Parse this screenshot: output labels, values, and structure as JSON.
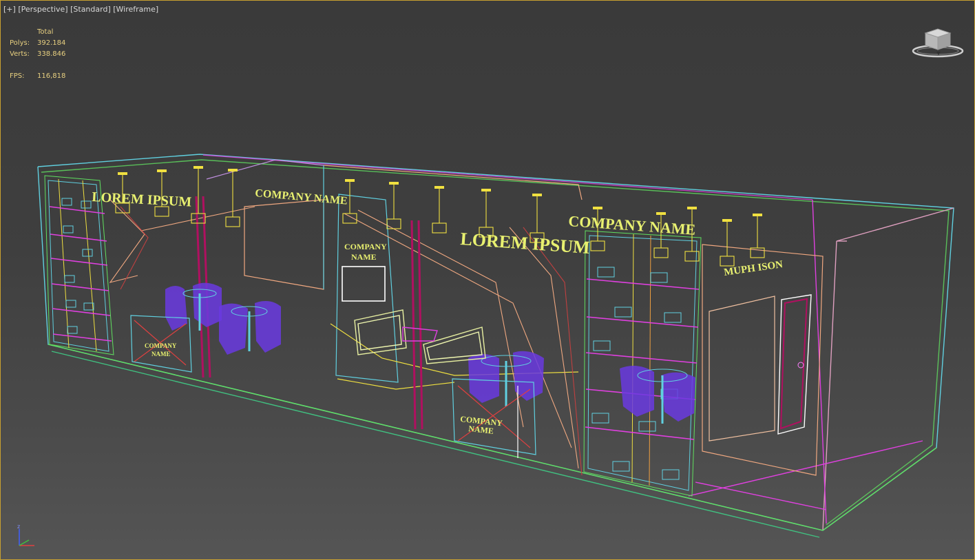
{
  "viewport": {
    "labels": [
      "[+]",
      "[Perspective]",
      "[Standard]",
      "[Wireframe]"
    ]
  },
  "stats": {
    "header": "Total",
    "polys_label": "Polys:",
    "polys_value": "392.184",
    "verts_label": "Verts:",
    "verts_value": "338.846",
    "fps_label": "FPS:",
    "fps_value": "116,818"
  },
  "scene_text": {
    "lorem_left": "LOREM IPSUM",
    "company_top": "COMPANY NAME",
    "company_panel_1": "COMPANY",
    "company_panel_2": "NAME",
    "lorem_center": "LOREM IPSUM",
    "company_right": "COMPANY NAME",
    "counter_left_1": "COMPANY",
    "counter_left_2": "NAME",
    "counter_center_1": "COMPANY",
    "counter_center_2": "NAME",
    "right_sign": "MUPH ISON"
  },
  "icons": {
    "viewcube": "viewcube-icon",
    "axis": "axis-tripod-icon"
  },
  "colors": {
    "frame_border": "#c8a030",
    "stats_text": "#e8d080",
    "wire_cyan": "#60d0e0",
    "wire_green": "#60e060",
    "wire_pink": "#e040e0",
    "wire_yellow": "#f0e040",
    "wire_maroon": "#b01060",
    "wire_purple": "#6a3ae0"
  }
}
